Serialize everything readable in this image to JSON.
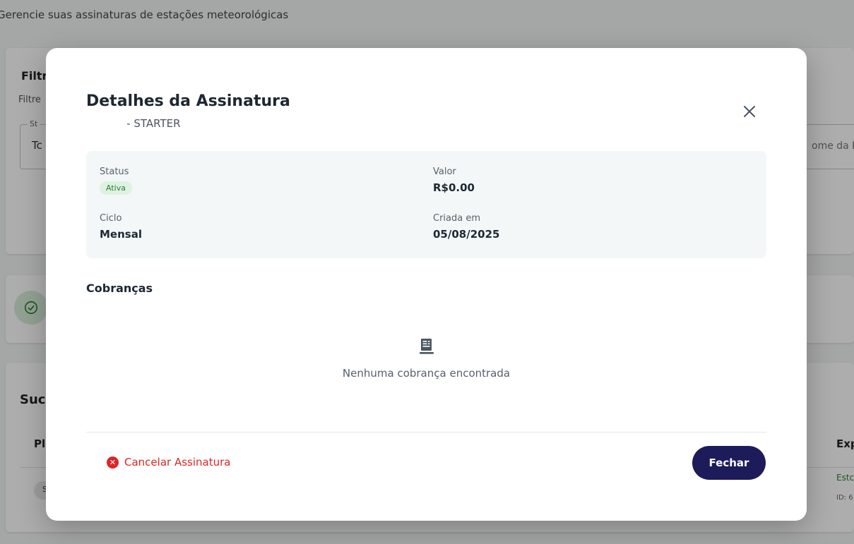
{
  "background": {
    "subtitle": "Gerencie suas assinaturas de estações meteorológicas",
    "filter_title": "Filtr",
    "filter_desc": "Filtre",
    "status_legend": "St",
    "status_value": "Tc",
    "name_placeholder": "ome da E",
    "list_title": "Suc",
    "col_plano": "Pl",
    "col_exp": "Exp",
    "row_chip": "S",
    "row_status": "Estc",
    "row_id": "ID: 6"
  },
  "modal": {
    "title": "Detalhes da Assinatura",
    "subtitle": "- STARTER",
    "close_icon": "close-icon",
    "details": {
      "status_label": "Status",
      "status_value": "Ativa",
      "valor_label": "Valor",
      "valor_value": "R$0.00",
      "ciclo_label": "Ciclo",
      "ciclo_value": "Mensal",
      "criada_label": "Criada em",
      "criada_value": "05/08/2025"
    },
    "charges_title": "Cobranças",
    "empty_icon": "receipt-icon",
    "empty_text": "Nenhuma cobrança encontrada",
    "cancel_label": "Cancelar Assinatura",
    "close_label": "Fechar"
  },
  "colors": {
    "primary": "#1e1b5b",
    "danger": "#dc2626",
    "success": "#2e7d32",
    "details_bg": "#f3f7f7"
  }
}
